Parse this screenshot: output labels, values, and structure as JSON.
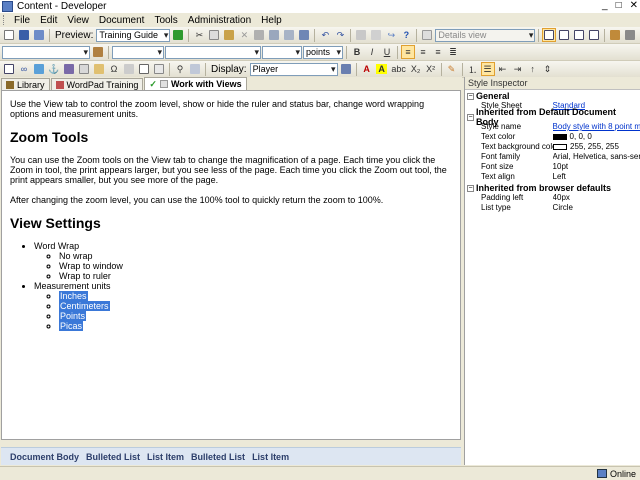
{
  "window": {
    "title": "Content - Developer",
    "controls": [
      "_",
      "□",
      "✕"
    ]
  },
  "menu": [
    "File",
    "Edit",
    "View",
    "Document",
    "Tools",
    "Administration",
    "Help"
  ],
  "toolbar1": {
    "preview_label": "Preview:",
    "preview_value": "Training Guide",
    "view_value": "Details view"
  },
  "toolbar2": {
    "font_size_unit": "points",
    "bold": "B",
    "italic": "I",
    "underline": "U"
  },
  "toolbar3": {
    "display_label": "Display:",
    "display_value": "Player",
    "abc": "abc",
    "sub": "X₂",
    "sup": "X²"
  },
  "tabs": [
    {
      "label": "Library",
      "icon_color": "#8a6a2a"
    },
    {
      "label": "WordPad Training",
      "icon_color": "#c05050"
    },
    {
      "label": "Work with Views",
      "icon_color": "#2a9a2a",
      "active": true
    }
  ],
  "doc": {
    "intro": "Use the View tab to control the zoom level, show or hide the ruler and status bar, change word wrapping options and measurement units.",
    "h_zoom": "Zoom Tools",
    "p_zoom1": "You can use the Zoom tools on the View tab to change the magnification of a page. Each time you click the Zoom in tool, the print appears larger, but you see less of the page. Each time you click the Zoom out tool, the print appears smaller, but you see more of the page.",
    "p_zoom2": "After changing the zoom level, you can use the 100% tool to quickly return the zoom to 100%.",
    "h_view": "View Settings",
    "list": {
      "word_wrap": "Word Wrap",
      "ww_items": [
        "No wrap",
        "Wrap to window",
        "Wrap to ruler"
      ],
      "units": "Measurement units",
      "unit_items": [
        "Inches",
        "Centimeters",
        "Points",
        "Picas"
      ]
    }
  },
  "breadcrumbs": [
    "Document Body",
    "Bulleted List",
    "List Item",
    "Bulleted List",
    "List Item"
  ],
  "inspector": {
    "title": "Style Inspector",
    "groups": [
      {
        "name": "General",
        "rows": [
          {
            "k": "Style Sheet",
            "v": "Standard",
            "link": true
          }
        ]
      },
      {
        "name": "Inherited from Default Document Body",
        "rows": [
          {
            "k": "Style name",
            "v": "Body style with 8 point m...",
            "link": true
          },
          {
            "k": "Text color",
            "v": "0, 0, 0",
            "swatch": "#000000"
          },
          {
            "k": "Text background color",
            "v": "255, 255, 255",
            "swatch": "#ffffff"
          },
          {
            "k": "Font family",
            "v": "Arial, Helvetica, sans-serif"
          },
          {
            "k": "Font size",
            "v": "10pt"
          },
          {
            "k": "Text align",
            "v": "Left"
          }
        ]
      },
      {
        "name": "Inherited from browser defaults",
        "rows": [
          {
            "k": "Padding left",
            "v": "40px"
          },
          {
            "k": "List type",
            "v": "Circle"
          }
        ]
      }
    ]
  },
  "status": {
    "connection": "Online"
  },
  "colors": {
    "selection": "#3a78d8",
    "breadcrumb_bg": "#dde6f2",
    "link": "#0033cc"
  }
}
